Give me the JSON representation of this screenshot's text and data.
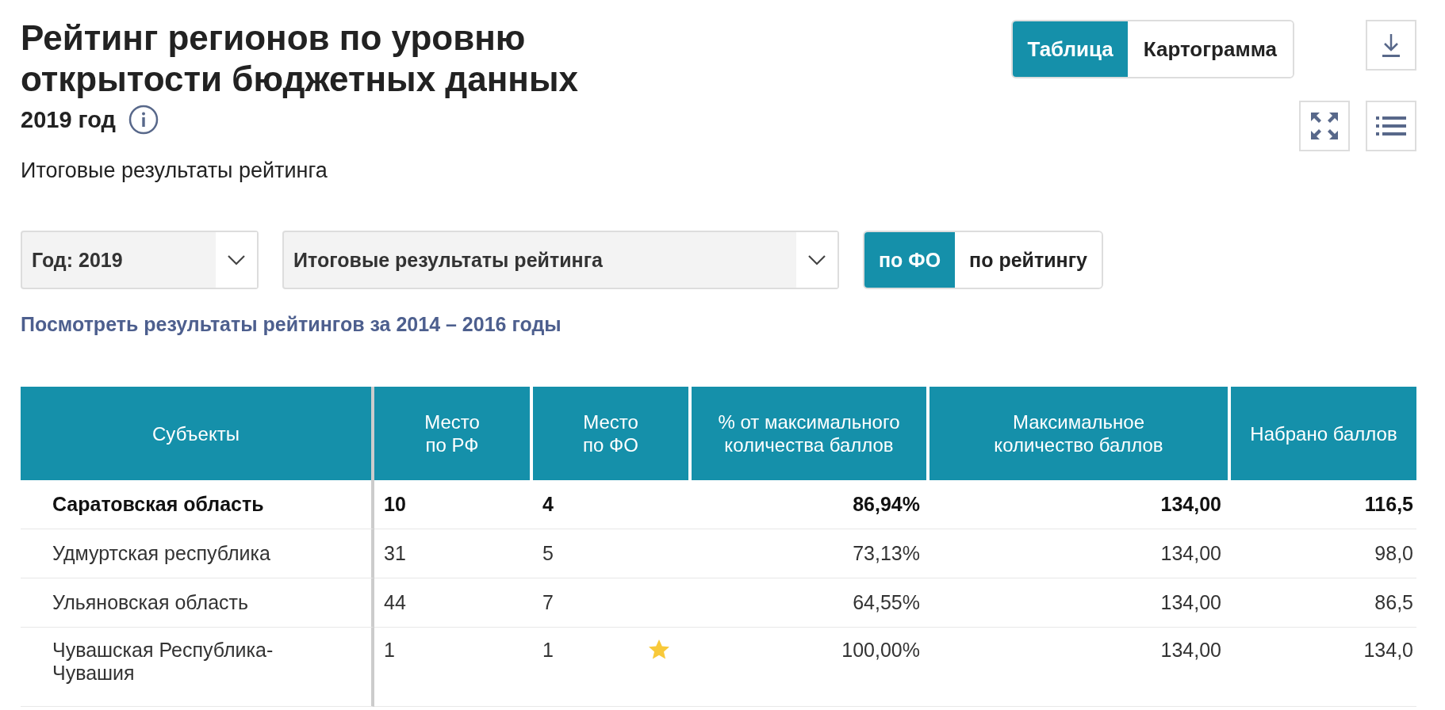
{
  "title": "Рейтинг регионов по уровню открытости бюджетных данных",
  "year_label": "2019 год",
  "subtitle": "Итоговые результаты рейтинга",
  "view_tabs": [
    {
      "label": "Таблица",
      "selected": true
    },
    {
      "label": "Картограмма",
      "selected": false
    }
  ],
  "filters": [
    {
      "label": "Год: 2019"
    },
    {
      "label": "Итоговые результаты рейтинга"
    }
  ],
  "sort_tabs": [
    {
      "label": "по ФО",
      "selected": true
    },
    {
      "label": "по рейтингу",
      "selected": false
    }
  ],
  "archive_link": "Посмотреть результаты рейтингов за 2014 – 2016 годы",
  "table": {
    "columns": [
      "Субъекты",
      "Место по РФ",
      "Место по ФО",
      "% от максимального количества баллов",
      "Максимальное количество баллов",
      "Набрано баллов"
    ],
    "rows": [
      {
        "highlighted": true,
        "starred": false,
        "cells": [
          "Саратовская область",
          "10",
          "4",
          "86,94%",
          "134,00",
          "116,5"
        ]
      },
      {
        "highlighted": false,
        "starred": false,
        "cells": [
          "Удмуртская республика",
          "31",
          "5",
          "73,13%",
          "134,00",
          "98,0"
        ]
      },
      {
        "highlighted": false,
        "starred": false,
        "cells": [
          "Ульяновская область",
          "44",
          "7",
          "64,55%",
          "134,00",
          "86,5"
        ]
      },
      {
        "highlighted": false,
        "starred": true,
        "cells": [
          "Чувашская Республика-Чувашия",
          "1",
          "1",
          "100,00%",
          "134,00",
          "134,0"
        ]
      }
    ]
  }
}
